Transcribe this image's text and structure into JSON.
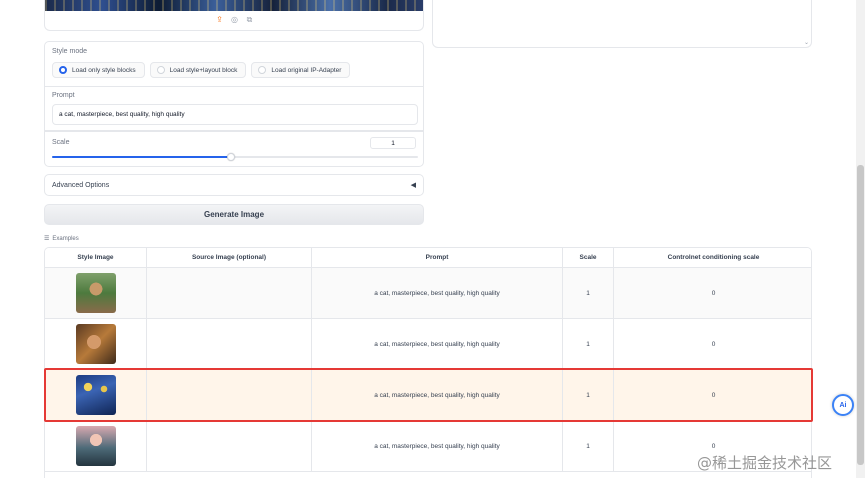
{
  "image_tools": {
    "upload_icon": "upload-icon",
    "share_icon": "share-icon",
    "edit_icon": "image-edit-icon"
  },
  "style_mode": {
    "label": "Style mode",
    "options": [
      {
        "label": "Load only style blocks",
        "selected": true
      },
      {
        "label": "Load style+layout block",
        "selected": false
      },
      {
        "label": "Load original IP-Adapter",
        "selected": false
      }
    ]
  },
  "prompt": {
    "label": "Prompt",
    "value": "a cat, masterpiece, best quality, high quality"
  },
  "scale": {
    "label": "Scale",
    "value": "1",
    "slider_fraction": 0.5
  },
  "advanced": {
    "label": "Advanced Options",
    "caret": "◀"
  },
  "generate_button": "Generate Image",
  "examples": {
    "label": "Examples",
    "columns": [
      "Style Image",
      "Source Image (optional)",
      "Prompt",
      "Scale",
      "Controlnet conditioning scale"
    ],
    "rows": [
      {
        "prompt": "a cat, masterpiece, best quality, high quality",
        "scale": "1",
        "controlnet": "0"
      },
      {
        "prompt": "a cat, masterpiece, best quality, high quality",
        "scale": "1",
        "controlnet": "0"
      },
      {
        "prompt": "a cat, masterpiece, best quality, high quality",
        "scale": "1",
        "controlnet": "0"
      },
      {
        "prompt": "a cat, masterpiece, best quality, high quality",
        "scale": "1",
        "controlnet": "0"
      }
    ],
    "highlighted_row": 3
  },
  "ai_button": "Ai",
  "watermark": "@稀土掘金技术社区",
  "colors": {
    "accent": "#2563eb",
    "highlight_border": "#e53935",
    "highlight_row_bg": "#fff5ea"
  }
}
